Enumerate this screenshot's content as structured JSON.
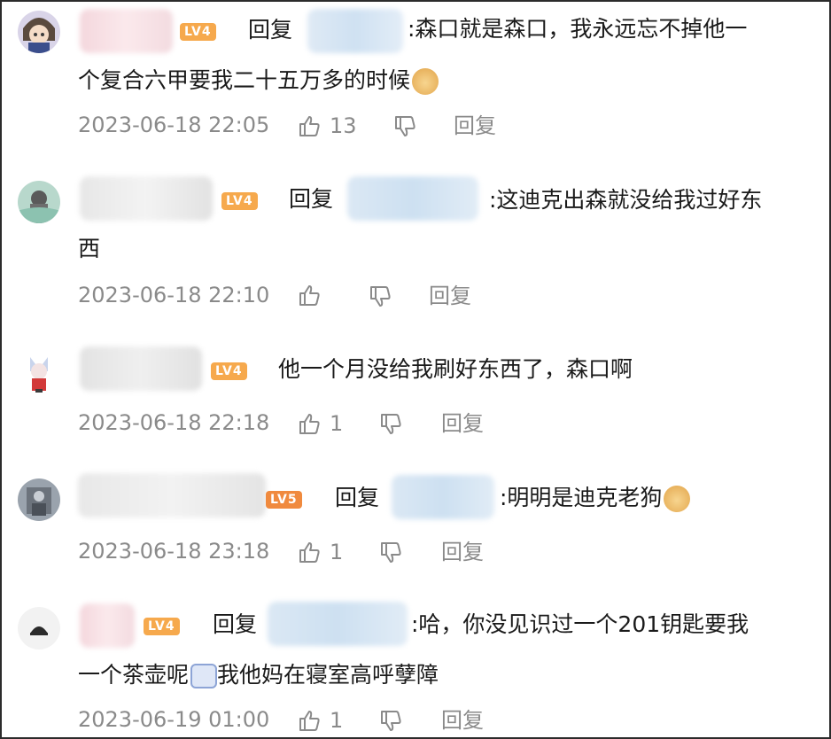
{
  "reply_word": "回复",
  "comments": [
    {
      "level": "LV4",
      "text_line1": ":森口就是森口，我永远忘不掉他一",
      "text_line2": "个复合六甲要我二十五万多的时候",
      "emoji": "doge-emoji",
      "time": "2023-06-18 22:05",
      "likes": "13",
      "reply_label": "回复"
    },
    {
      "level": "LV4",
      "text_line1": ":这迪克出森就没给我过好东",
      "text_line2": "西",
      "time": "2023-06-18 22:10",
      "likes": "",
      "reply_label": "回复"
    },
    {
      "level": "LV4",
      "text_line1": "他一个月没给我刷好东西了，森口啊",
      "time": "2023-06-18 22:18",
      "likes": "1",
      "reply_label": "回复"
    },
    {
      "level": "LV5",
      "text_line1": ":明明是迪克老狗",
      "emoji": "doge-emoji",
      "time": "2023-06-18 23:18",
      "likes": "1",
      "reply_label": "回复"
    },
    {
      "level": "LV4",
      "text_line1": ":哈，你没见识过一个201钥匙要我",
      "text_line2_pre": "一个茶壶呢",
      "text_line2_post": "我他妈在寝室高呼孽障",
      "emoji": "tv-emoji",
      "time": "2023-06-19 01:00",
      "likes": "1",
      "reply_label": "回复"
    }
  ],
  "colors": {
    "lv4": "#f6a94d",
    "lv5": "#f08a3e",
    "meta": "#8a8a8a",
    "text": "#1a1a1a"
  }
}
